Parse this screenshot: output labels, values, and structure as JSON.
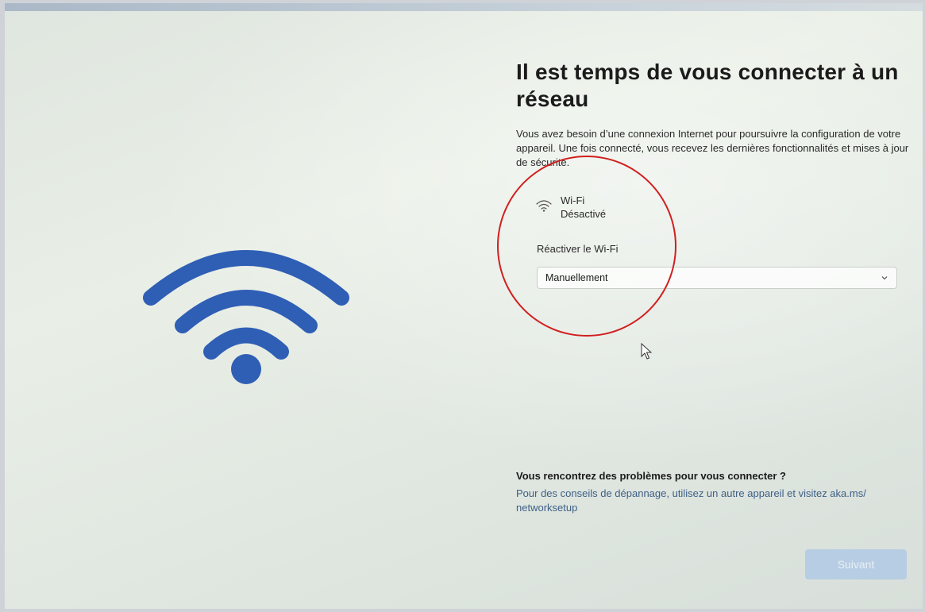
{
  "header": {
    "title": "Il est temps de vous connecter à un réseau"
  },
  "description": "Vous avez besoin d’une connexion Internet pour poursuivre la configuration de votre appareil. Une fois connecté, vous recevez les dernières fonctionnalités et mises à jour de sécurité.",
  "network": {
    "name": "Wi-Fi",
    "status": "Désactivé",
    "icon": "wifi-icon"
  },
  "reenable": {
    "label": "Réactiver le Wi-Fi",
    "selected": "Manuellement"
  },
  "help": {
    "title": "Vous rencontrez des problèmes pour vous connecter ?",
    "text": "Pour des conseils de dépannage, utilisez un autre appareil et visitez aka.ms/ networksetup"
  },
  "buttons": {
    "next": "Suivant"
  },
  "colors": {
    "wifi_blue": "#2f5eb5",
    "annotation_red": "#d11f1f",
    "link_blue": "#3e5f86",
    "button_disabled": "#b7cde3"
  }
}
